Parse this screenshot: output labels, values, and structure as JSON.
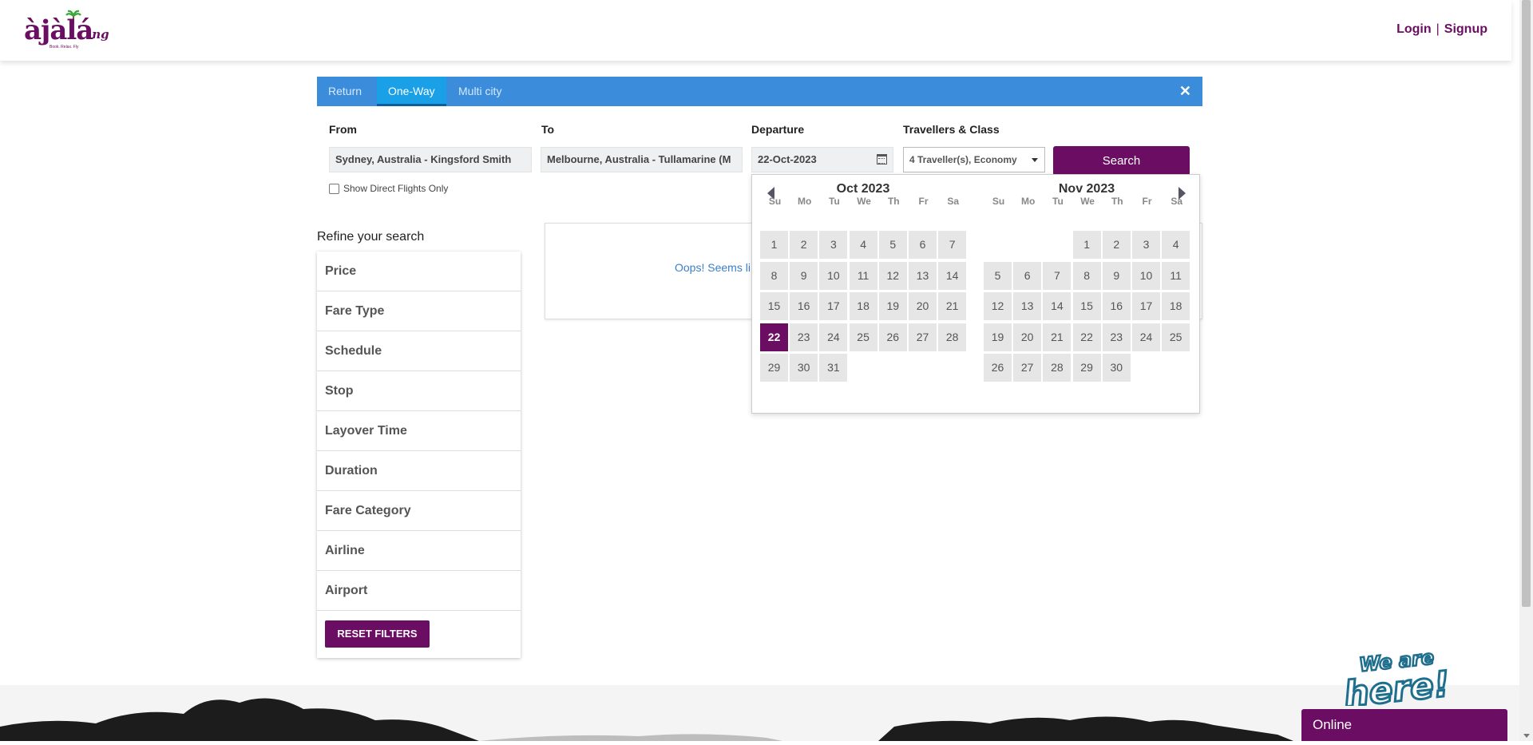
{
  "header": {
    "logo_text": "àjàlá",
    "logo_suffix": ".ng",
    "logo_tagline": "Book. Relax. Fly",
    "login_label": "Login",
    "separator": "|",
    "signup_label": "Signup"
  },
  "trip_tabs": {
    "items": [
      {
        "label": "Return"
      },
      {
        "label": "One-Way"
      },
      {
        "label": "Multi city"
      }
    ],
    "active": "One-Way",
    "close_icon": "close-icon"
  },
  "search_form": {
    "from_label": "From",
    "from_value": "Sydney, Australia - Kingsford Smith",
    "to_label": "To",
    "to_value": "Melbourne, Australia - Tullamarine (M",
    "departure_label": "Departure",
    "departure_value": "22-Oct-2023",
    "travellers_label": "Travellers & Class",
    "travellers_value": "4 Traveller(s), Economy",
    "search_label": "Search",
    "direct_only_label": "Show Direct Flights Only",
    "direct_only_checked": false
  },
  "refine": {
    "title": "Refine your search",
    "filters": [
      {
        "label": "Price"
      },
      {
        "label": "Fare Type"
      },
      {
        "label": "Schedule"
      },
      {
        "label": "Stop"
      },
      {
        "label": "Layover Time"
      },
      {
        "label": "Duration"
      },
      {
        "label": "Fare Category"
      },
      {
        "label": "Airline"
      },
      {
        "label": "Airport"
      }
    ],
    "reset_label": "RESET FILTERS"
  },
  "results": {
    "message": "Oops! Seems li"
  },
  "datepicker": {
    "weekdays": [
      "Su",
      "Mo",
      "Tu",
      "We",
      "Th",
      "Fr",
      "Sa"
    ],
    "selected_date": "22",
    "months": [
      {
        "title": "Oct 2023",
        "first_weekday": 0,
        "days": 31
      },
      {
        "title": "Nov 2023",
        "first_weekday": 3,
        "days": 30
      }
    ]
  },
  "chat": {
    "badge_text": "We are here!",
    "status_label": "Online"
  },
  "colors": {
    "brand": "#6b0d62",
    "tab_bar": "#3b8ddc",
    "tab_active": "#1aa0e6",
    "link": "#3b7fc8"
  }
}
